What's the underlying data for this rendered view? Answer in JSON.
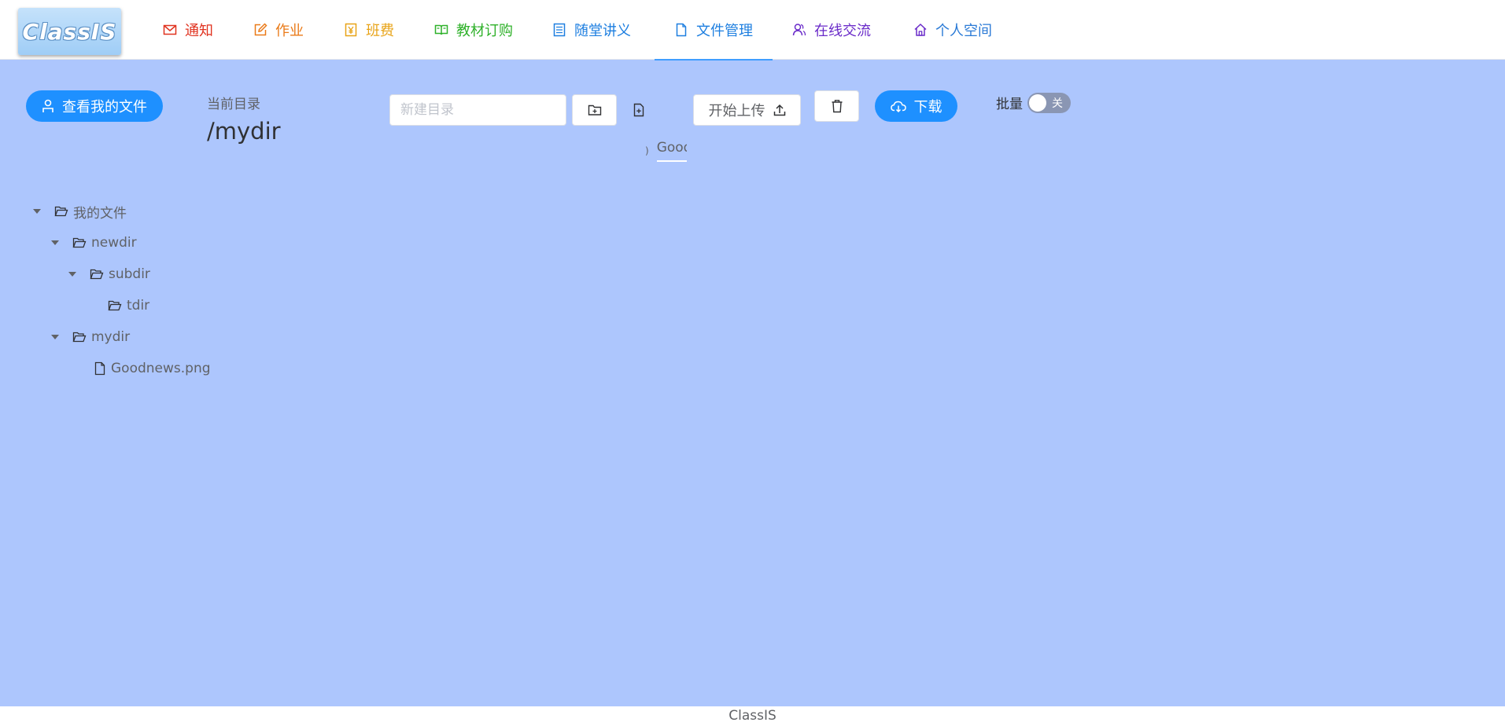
{
  "app": {
    "logo_text": "ClassIS",
    "footer_text": "ClassIS"
  },
  "nav": {
    "items": [
      {
        "label": "通知",
        "icon": "mail-icon",
        "color": "#e0321f"
      },
      {
        "label": "作业",
        "icon": "edit-icon",
        "color": "#ea7a18"
      },
      {
        "label": "班费",
        "icon": "yen-icon",
        "color": "#e8a317"
      },
      {
        "label": "教材订购",
        "icon": "book-icon",
        "color": "#2fb12a"
      },
      {
        "label": "随堂讲义",
        "icon": "list-icon",
        "color": "#1e7fe0"
      },
      {
        "label": "文件管理",
        "icon": "document-icon",
        "color": "#1e7fe0"
      },
      {
        "label": "在线交流",
        "icon": "users-icon",
        "color": "#6a2bc9"
      },
      {
        "label": "个人空间",
        "icon": "home-icon",
        "color": "#2a7ad6"
      }
    ],
    "active_index": 5
  },
  "toolbar": {
    "my_files_label": "查看我的文件",
    "current_dir_label": "当前目录",
    "current_dir": "/mydir",
    "new_dir_placeholder": "新建目录",
    "new_dir_value": "",
    "upload_label": "开始上传",
    "download_label": "下载",
    "batch_label": "批量",
    "batch_switch_text": "关",
    "batch_on": false,
    "upload_file_name": "Goodnews.png"
  },
  "tree": {
    "nodes": [
      {
        "label": "我的文件",
        "type": "folder",
        "level": 0,
        "expanded": true
      },
      {
        "label": "newdir",
        "type": "folder",
        "level": 1,
        "expanded": true
      },
      {
        "label": "subdir",
        "type": "folder",
        "level": 2,
        "expanded": true
      },
      {
        "label": "tdir",
        "type": "folder",
        "level": 3,
        "expanded": false
      },
      {
        "label": "mydir",
        "type": "folder",
        "level": 1,
        "expanded": true
      },
      {
        "label": "Goodnews.png",
        "type": "file",
        "level": 2,
        "expanded": false
      }
    ]
  },
  "colors": {
    "background": "#adc6fd",
    "primary": "#1e90ff"
  }
}
